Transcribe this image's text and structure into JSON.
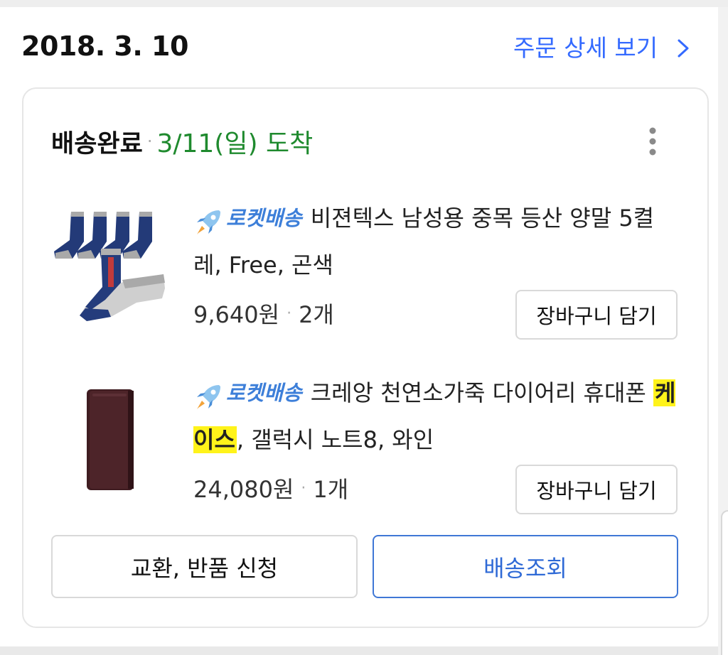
{
  "order": {
    "date": "2018. 3. 10",
    "detail_link": "주문 상세 보기"
  },
  "shipment": {
    "status": "배송완료",
    "separator": "·",
    "arrival": "3/11(일) 도착"
  },
  "items": [
    {
      "badge": "로켓배송",
      "title": "비젼텍스 남성용 중목 등산 양말 5켤레, Free, 곤색",
      "price": "9,640원",
      "quantity": "2개",
      "cart_label": "장바구니 담기",
      "image_icon": "socks-product-image"
    },
    {
      "badge": "로켓배송",
      "title_before": "크레앙 천연소가죽 다이어리 휴대폰 ",
      "title_highlight": "케이스",
      "title_after": ", 갤럭시 노트8, 와인",
      "price": "24,080원",
      "quantity": "1개",
      "cart_label": "장바구니 담기",
      "image_icon": "phone-case-product-image"
    }
  ],
  "actions": {
    "exchange_return": "교환, 반품 신청",
    "track_delivery": "배송조회"
  },
  "colors": {
    "link_blue": "#346aff",
    "arrival_green": "#1f8a2e",
    "badge_blue": "#3d7fd9",
    "highlight_yellow": "#fff31a",
    "track_border": "#3f77d6"
  }
}
